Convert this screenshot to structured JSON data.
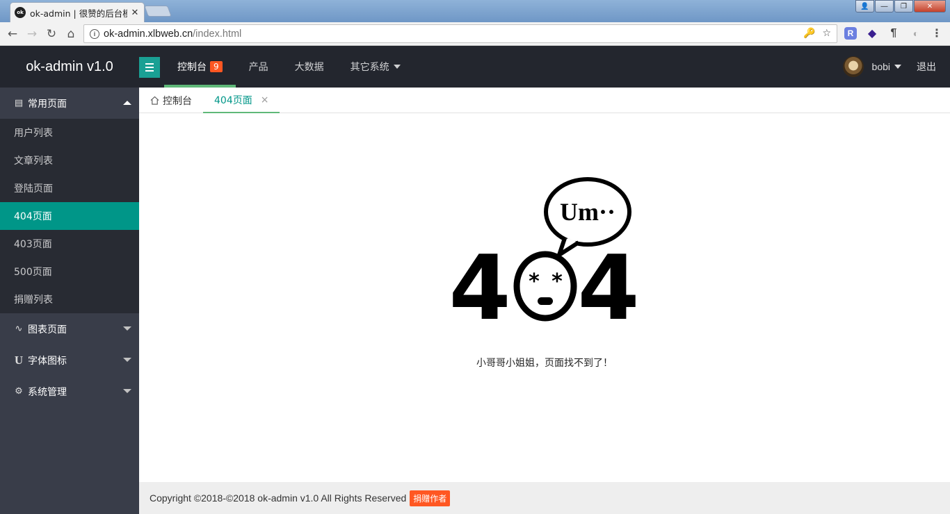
{
  "browser": {
    "tab_title": "ok-admin | 很赞的后台模",
    "favicon_text": "ok",
    "tab_close": "✕",
    "url_host": "ok-admin.xlbweb.cn",
    "url_path": "/index.html",
    "win_min": "—",
    "win_max": "❐",
    "win_close": "✕",
    "ext1": "R",
    "ext3": "¶"
  },
  "header": {
    "logo": "ok-admin v1.0",
    "nav": [
      {
        "label": "控制台",
        "badge": "9"
      },
      {
        "label": "产品"
      },
      {
        "label": "大数据"
      },
      {
        "label": "其它系统"
      }
    ],
    "user_name": "bobi",
    "logout": "退出"
  },
  "sidebar": {
    "groups": [
      {
        "label": "常用页面",
        "icon": "▤",
        "items": [
          "用户列表",
          "文章列表",
          "登陆页面",
          "404页面",
          "403页面",
          "500页面",
          "捐赠列表"
        ]
      },
      {
        "label": "图表页面",
        "icon": "∿"
      },
      {
        "label": "字体图标",
        "icon": "U"
      },
      {
        "label": "系统管理",
        "icon": "⚙"
      }
    ],
    "active_item": "404页面"
  },
  "content_tabs": [
    {
      "label": "控制台"
    },
    {
      "label": "404页面",
      "close": "×"
    }
  ],
  "main": {
    "bubble_text": "Um··",
    "code_left": "4",
    "code_right": "4",
    "message": "小哥哥小姐姐，页面找不到了！"
  },
  "footer": {
    "copyright": "Copyright ©2018-©2018 ok-admin v1.0 All Rights Reserved",
    "donate": "捐赠作者"
  },
  "colors": {
    "header_bg": "#23262e",
    "sidebar_bg": "#393d49",
    "accent": "#009688",
    "badge": "#ff5722"
  }
}
